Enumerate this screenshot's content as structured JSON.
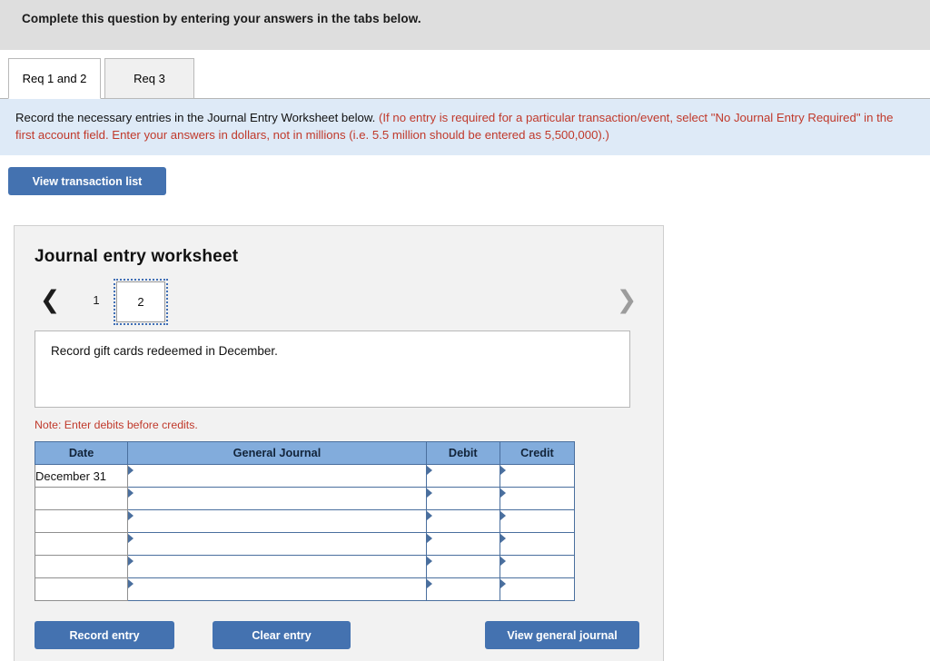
{
  "header": {
    "instruction": "Complete this question by entering your answers in the tabs below."
  },
  "tabs": [
    {
      "label": "Req 1 and 2",
      "active": true
    },
    {
      "label": "Req 3",
      "active": false
    }
  ],
  "info_panel": {
    "text_black": "Record the necessary entries in the Journal Entry Worksheet below.",
    "text_red": "(If no entry is required for a particular transaction/event, select \"No Journal Entry Required\" in the first account field. Enter your answers in dollars, not in millions (i.e. 5.5 million should be entered as 5,500,000).)"
  },
  "toolbar": {
    "view_transaction_list_label": "View transaction list"
  },
  "worksheet": {
    "title": "Journal entry worksheet",
    "pager": {
      "prev_icon": "chevron-left-icon",
      "next_icon": "chevron-right-icon",
      "pages": [
        "1",
        "2"
      ],
      "selected_page": "2"
    },
    "description": "Record gift cards redeemed in December.",
    "note": "Note: Enter debits before credits.",
    "table": {
      "columns": [
        "Date",
        "General Journal",
        "Debit",
        "Credit"
      ],
      "rows": [
        {
          "date": "December 31",
          "general_journal": "",
          "debit": "",
          "credit": ""
        },
        {
          "date": "",
          "general_journal": "",
          "debit": "",
          "credit": ""
        },
        {
          "date": "",
          "general_journal": "",
          "debit": "",
          "credit": ""
        },
        {
          "date": "",
          "general_journal": "",
          "debit": "",
          "credit": ""
        },
        {
          "date": "",
          "general_journal": "",
          "debit": "",
          "credit": ""
        },
        {
          "date": "",
          "general_journal": "",
          "debit": "",
          "credit": ""
        }
      ]
    },
    "buttons": {
      "record_entry": "Record entry",
      "clear_entry": "Clear entry",
      "view_general_journal": "View general journal"
    }
  },
  "colors": {
    "accent_blue": "#4472b0",
    "table_header_blue": "#82acdc",
    "info_panel_blue": "#deeaf7",
    "note_red": "#c0392b",
    "topbar_grey": "#dedede",
    "panel_grey": "#f2f2f2"
  }
}
